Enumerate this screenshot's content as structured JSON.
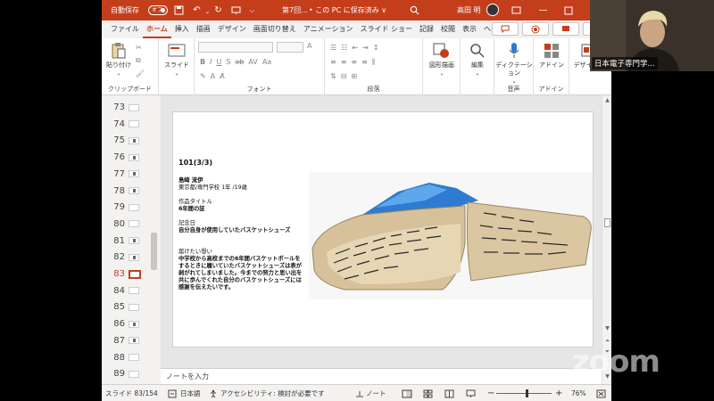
{
  "titlebar": {
    "autosave_label": "自動保存",
    "autosave_state": "オフ",
    "document_title": "第7回…",
    "save_location": "• この PC に保存済み ∨",
    "user_name": "高田 明"
  },
  "tabs": [
    "ファイル",
    "ホーム",
    "挿入",
    "描画",
    "デザイン",
    "画面切り替え",
    "アニメーション",
    "スライド ショー",
    "記録",
    "校閲",
    "表示",
    "ヘルプ"
  ],
  "active_tab": "ホーム",
  "ribbon": {
    "paste_label": "貼り付け",
    "clipboard_group": "クリップボード",
    "slide_label": "スライド",
    "font_group": "フォント",
    "paragraph_group": "段落",
    "shapes_label": "図形描画",
    "edit_label": "編集",
    "dictation_label": "ディクテーション",
    "voice_group": "音声",
    "addin_label": "アドイン",
    "addin_group": "アドイン",
    "designer_label": "デザイナー"
  },
  "thumbnails": [
    {
      "num": "73",
      "selected": false,
      "mark": false
    },
    {
      "num": "74",
      "selected": false,
      "mark": false
    },
    {
      "num": "75",
      "selected": false,
      "mark": true
    },
    {
      "num": "76",
      "selected": false,
      "mark": true
    },
    {
      "num": "77",
      "selected": false,
      "mark": true
    },
    {
      "num": "78",
      "selected": false,
      "mark": true
    },
    {
      "num": "79",
      "selected": false,
      "mark": false
    },
    {
      "num": "80",
      "selected": false,
      "mark": false
    },
    {
      "num": "81",
      "selected": false,
      "mark": true
    },
    {
      "num": "82",
      "selected": false,
      "mark": true
    },
    {
      "num": "83",
      "selected": true,
      "mark": false
    },
    {
      "num": "84",
      "selected": false,
      "mark": false
    },
    {
      "num": "85",
      "selected": false,
      "mark": false
    },
    {
      "num": "86",
      "selected": false,
      "mark": true
    },
    {
      "num": "87",
      "selected": false,
      "mark": true
    },
    {
      "num": "88",
      "selected": false,
      "mark": false
    },
    {
      "num": "89",
      "selected": false,
      "mark": false
    }
  ],
  "slide": {
    "title": "101(3/3)",
    "name": "島崎 流伊",
    "affiliation": "東京都/専門学校 1年 /19歳",
    "work_title_label": "作品タイトル",
    "work_title": "6年間の証",
    "anniversary_label": "記念日",
    "anniversary": "自分自身が使用していたバスケットシューズ",
    "message_label": "届けたい想い",
    "message": "中学校から高校までの6年間バスケットボールをするときに履いていたバスケットシューズは表が剥がれてしまいました。今までの努力と思い出を共に歩んでくれた自分のバスケットシューズには感謝を伝えたいです。"
  },
  "notes_placeholder": "ノートを入力",
  "statusbar": {
    "slide_count": "スライド 83/154",
    "language": "日本語",
    "accessibility": "アクセシビリティ: 検討が必要です",
    "notes_label": "ノート",
    "zoom": "76%",
    "zoom_fraction": 0.55
  },
  "webcam": {
    "participant_name": "日本電子専門学..."
  },
  "zoom_brand": "zoom",
  "colors": {
    "accent": "#c43e1c",
    "ribbon_bg": "#ffffff",
    "canvas_bg": "#e6e6e6"
  }
}
